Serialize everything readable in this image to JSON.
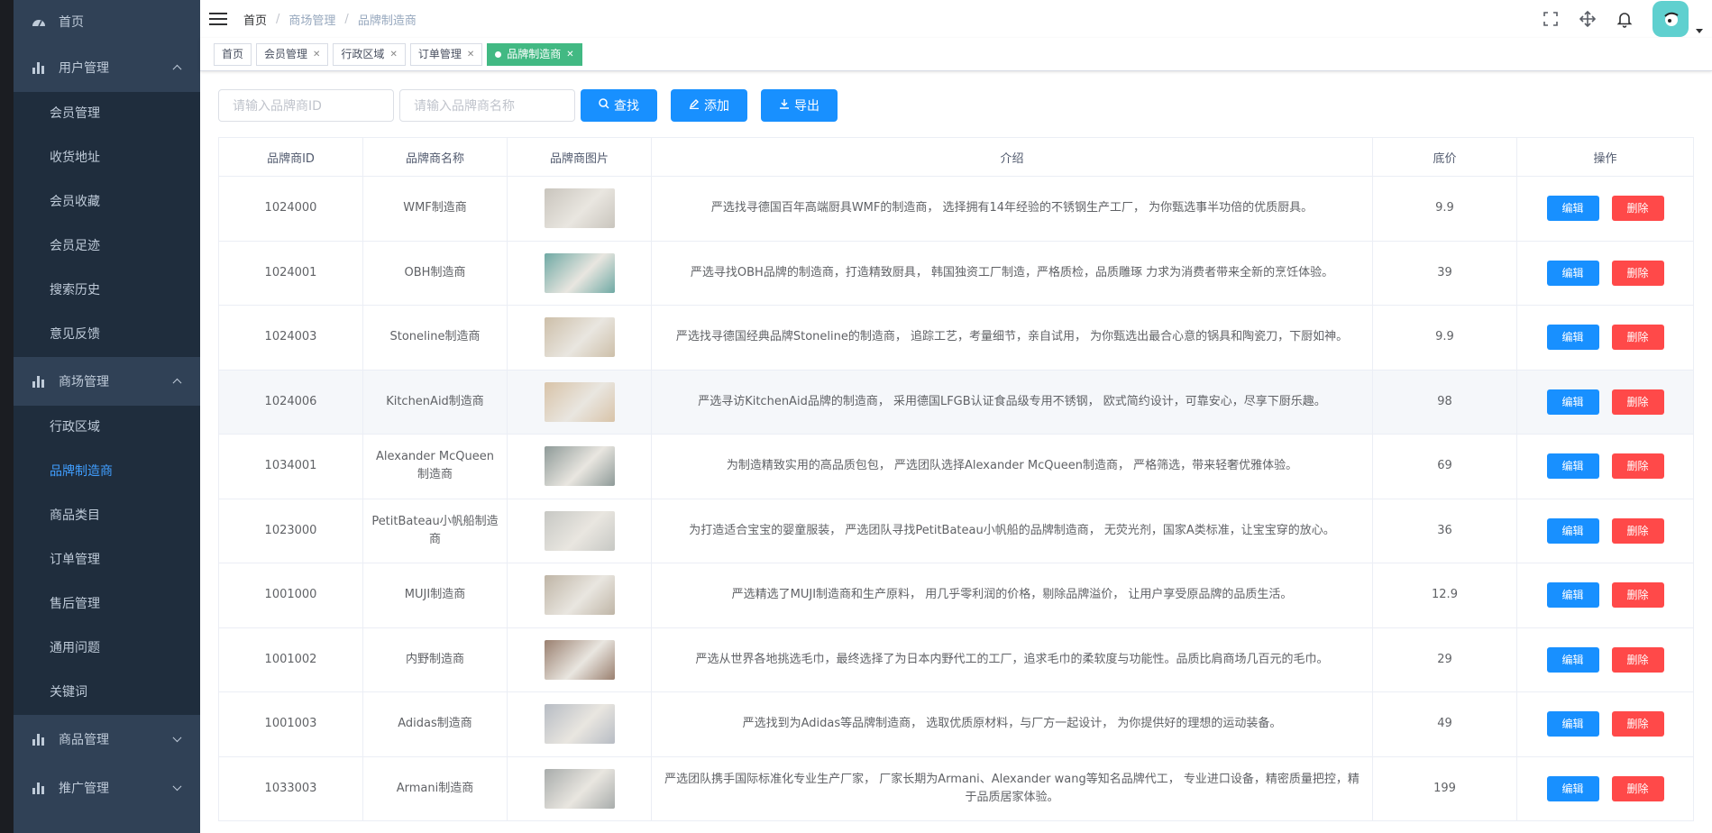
{
  "sidebar": {
    "home_label": "首页",
    "user_mgmt": {
      "label": "用户管理",
      "items": [
        "会员管理",
        "收货地址",
        "会员收藏",
        "会员足迹",
        "搜索历史",
        "意见反馈"
      ]
    },
    "mall_mgmt": {
      "label": "商场管理",
      "items": [
        "行政区域",
        "品牌制造商",
        "商品类目",
        "订单管理",
        "售后管理",
        "通用问题",
        "关键词"
      ]
    },
    "goods_mgmt": {
      "label": "商品管理"
    },
    "promo_mgmt": {
      "label": "推广管理"
    },
    "active_item": "品牌制造商"
  },
  "navbar": {
    "breadcrumb": [
      "首页",
      "商场管理",
      "品牌制造商"
    ]
  },
  "tags": [
    {
      "label": "首页",
      "closable": false
    },
    {
      "label": "会员管理",
      "closable": true
    },
    {
      "label": "行政区域",
      "closable": true
    },
    {
      "label": "订单管理",
      "closable": true
    },
    {
      "label": "品牌制造商",
      "closable": true,
      "active": true
    }
  ],
  "filter": {
    "id_placeholder": "请输入品牌商ID",
    "name_placeholder": "请输入品牌商名称",
    "search_label": "查找",
    "add_label": "添加",
    "export_label": "导出"
  },
  "table": {
    "headers": [
      "品牌商ID",
      "品牌商名称",
      "品牌商图片",
      "介绍",
      "底价",
      "操作"
    ],
    "edit_label": "编辑",
    "delete_label": "删除",
    "rows": [
      {
        "id": "1024000",
        "name": "WMF制造商",
        "img": "#c9c5bd",
        "desc": "严选找寻德国百年高端厨具WMF的制造商， 选择拥有14年经验的不锈钢生产工厂， 为你甄选事半功倍的优质厨具。",
        "price": "9.9"
      },
      {
        "id": "1024001",
        "name": "OBH制造商",
        "img": "#6fa9a4",
        "desc": "严选寻找OBH品牌的制造商，打造精致厨具， 韩国独资工厂制造，严格质检，品质雕琢 力求为消费者带来全新的烹饪体验。",
        "price": "39"
      },
      {
        "id": "1024003",
        "name": "Stoneline制造商",
        "img": "#cdbfa9",
        "desc": "严选找寻德国经典品牌Stoneline的制造商， 追踪工艺，考量细节，亲自试用， 为你甄选出最合心意的锅具和陶瓷刀，下厨如神。",
        "price": "9.9"
      },
      {
        "id": "1024006",
        "name": "KitchenAid制造商",
        "img": "#d8c3a8",
        "desc": "严选寻访KitchenAid品牌的制造商， 采用德国LFGB认证食品级专用不锈钢， 欧式简约设计，可靠安心，尽享下厨乐趣。",
        "price": "98"
      },
      {
        "id": "1034001",
        "name": "Alexander McQueen制造商",
        "img": "#8e9a98",
        "desc": "为制造精致实用的高品质包包， 严选团队选择Alexander McQueen制造商， 严格筛选，带来轻奢优雅体验。",
        "price": "69"
      },
      {
        "id": "1023000",
        "name": "PetitBateau小帆船制造商",
        "img": "#c7c8c4",
        "desc": "为打造适合宝宝的婴童服装， 严选团队寻找PetitBateau小帆船的品牌制造商， 无荧光剂，国家A类标准，让宝宝穿的放心。",
        "price": "36"
      },
      {
        "id": "1001000",
        "name": "MUJI制造商",
        "img": "#bfb5a6",
        "desc": "严选精选了MUJI制造商和生产原料， 用几乎零利润的价格，剔除品牌溢价， 让用户享受原品牌的品质生活。",
        "price": "12.9"
      },
      {
        "id": "1001002",
        "name": "内野制造商",
        "img": "#9a8070",
        "desc": "严选从世界各地挑选毛巾，最终选择了为日本内野代工的工厂，追求毛巾的柔软度与功能性。品质比肩商场几百元的毛巾。",
        "price": "29"
      },
      {
        "id": "1001003",
        "name": "Adidas制造商",
        "img": "#b7bcc4",
        "desc": "严选找到为Adidas等品牌制造商， 选取优质原材料，与厂方一起设计， 为你提供好的理想的运动装备。",
        "price": "49"
      },
      {
        "id": "1033003",
        "name": "Armani制造商",
        "img": "#a8acab",
        "desc": "严选团队携手国际标准化专业生产厂家， 厂家长期为Armani、Alexander wang等知名品牌代工， 专业进口设备，精密质量把控，精于品质居家体验。",
        "price": "199"
      }
    ]
  }
}
